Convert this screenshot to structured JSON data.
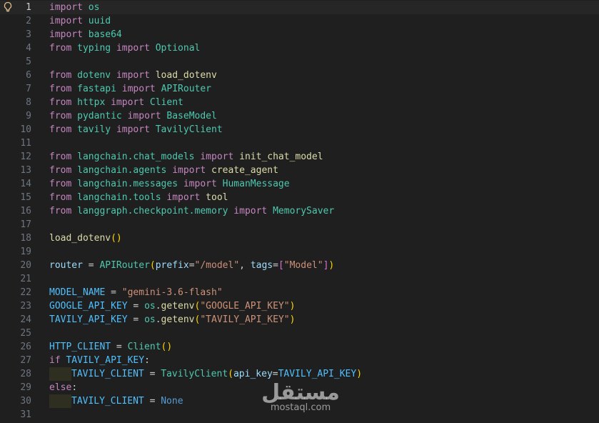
{
  "colors": {
    "background": "#1f1f1f",
    "current_line": "#262626",
    "gutter": "#6e7681",
    "keyword": "#c586c0",
    "module": "#4ec9b0",
    "function": "#dcdcaa",
    "variable": "#9cdcfe",
    "constant": "#4fc1ff",
    "string": "#ce9178",
    "constant_keyword": "#569cd6",
    "plain": "#cccccc",
    "bracket_yellow": "#ffd700",
    "bracket_purple": "#da70d6"
  },
  "gutter_icon": "lightbulb-icon",
  "current_line": 1,
  "lines": [
    {
      "n": "1",
      "t": [
        [
          "import",
          "kw"
        ],
        [
          " ",
          "p"
        ],
        [
          "os",
          "mod"
        ]
      ]
    },
    {
      "n": "2",
      "t": [
        [
          "import",
          "kw"
        ],
        [
          " ",
          "p"
        ],
        [
          "uuid",
          "mod"
        ]
      ]
    },
    {
      "n": "3",
      "t": [
        [
          "import",
          "kw"
        ],
        [
          " ",
          "p"
        ],
        [
          "base64",
          "mod"
        ]
      ]
    },
    {
      "n": "4",
      "t": [
        [
          "from",
          "kw"
        ],
        [
          " ",
          "p"
        ],
        [
          "typing",
          "mod"
        ],
        [
          " ",
          "p"
        ],
        [
          "import",
          "kw"
        ],
        [
          " ",
          "p"
        ],
        [
          "Optional",
          "mod"
        ]
      ]
    },
    {
      "n": "5",
      "t": []
    },
    {
      "n": "6",
      "t": [
        [
          "from",
          "kw"
        ],
        [
          " ",
          "p"
        ],
        [
          "dotenv",
          "mod"
        ],
        [
          " ",
          "p"
        ],
        [
          "import",
          "kw"
        ],
        [
          " ",
          "p"
        ],
        [
          "load_dotenv",
          "fn"
        ]
      ]
    },
    {
      "n": "7",
      "t": [
        [
          "from",
          "kw"
        ],
        [
          " ",
          "p"
        ],
        [
          "fastapi",
          "mod"
        ],
        [
          " ",
          "p"
        ],
        [
          "import",
          "kw"
        ],
        [
          " ",
          "p"
        ],
        [
          "APIRouter",
          "mod"
        ]
      ]
    },
    {
      "n": "8",
      "t": [
        [
          "from",
          "kw"
        ],
        [
          " ",
          "p"
        ],
        [
          "httpx",
          "mod"
        ],
        [
          " ",
          "p"
        ],
        [
          "import",
          "kw"
        ],
        [
          " ",
          "p"
        ],
        [
          "Client",
          "mod"
        ]
      ]
    },
    {
      "n": "9",
      "t": [
        [
          "from",
          "kw"
        ],
        [
          " ",
          "p"
        ],
        [
          "pydantic",
          "mod"
        ],
        [
          " ",
          "p"
        ],
        [
          "import",
          "kw"
        ],
        [
          " ",
          "p"
        ],
        [
          "BaseModel",
          "mod"
        ]
      ]
    },
    {
      "n": "10",
      "t": [
        [
          "from",
          "kw"
        ],
        [
          " ",
          "p"
        ],
        [
          "tavily",
          "mod"
        ],
        [
          " ",
          "p"
        ],
        [
          "import",
          "kw"
        ],
        [
          " ",
          "p"
        ],
        [
          "TavilyClient",
          "mod"
        ]
      ]
    },
    {
      "n": "11",
      "t": []
    },
    {
      "n": "12",
      "t": [
        [
          "from",
          "kw"
        ],
        [
          " ",
          "p"
        ],
        [
          "langchain.chat_models",
          "mod"
        ],
        [
          " ",
          "p"
        ],
        [
          "import",
          "kw"
        ],
        [
          " ",
          "p"
        ],
        [
          "init_chat_model",
          "fn"
        ]
      ]
    },
    {
      "n": "13",
      "t": [
        [
          "from",
          "kw"
        ],
        [
          " ",
          "p"
        ],
        [
          "langchain.agents",
          "mod"
        ],
        [
          " ",
          "p"
        ],
        [
          "import",
          "kw"
        ],
        [
          " ",
          "p"
        ],
        [
          "create_agent",
          "fn"
        ]
      ]
    },
    {
      "n": "14",
      "t": [
        [
          "from",
          "kw"
        ],
        [
          " ",
          "p"
        ],
        [
          "langchain.messages",
          "mod"
        ],
        [
          " ",
          "p"
        ],
        [
          "import",
          "kw"
        ],
        [
          " ",
          "p"
        ],
        [
          "HumanMessage",
          "mod"
        ]
      ]
    },
    {
      "n": "15",
      "t": [
        [
          "from",
          "kw"
        ],
        [
          " ",
          "p"
        ],
        [
          "langchain.tools",
          "mod"
        ],
        [
          " ",
          "p"
        ],
        [
          "import",
          "kw"
        ],
        [
          " ",
          "p"
        ],
        [
          "tool",
          "fn"
        ]
      ]
    },
    {
      "n": "16",
      "t": [
        [
          "from",
          "kw"
        ],
        [
          " ",
          "p"
        ],
        [
          "langgraph.checkpoint.memory",
          "mod"
        ],
        [
          " ",
          "p"
        ],
        [
          "import",
          "kw"
        ],
        [
          " ",
          "p"
        ],
        [
          "MemorySaver",
          "mod"
        ]
      ]
    },
    {
      "n": "17",
      "t": []
    },
    {
      "n": "18",
      "t": [
        [
          "load_dotenv",
          "fn"
        ],
        [
          "()",
          "by"
        ]
      ]
    },
    {
      "n": "19",
      "t": []
    },
    {
      "n": "20",
      "t": [
        [
          "router",
          "var"
        ],
        [
          " = ",
          "p"
        ],
        [
          "APIRouter",
          "mod"
        ],
        [
          "(",
          "by"
        ],
        [
          "prefix",
          "var"
        ],
        [
          "=",
          "p"
        ],
        [
          "\"/model\"",
          "str"
        ],
        [
          ", ",
          "p"
        ],
        [
          "tags",
          "var"
        ],
        [
          "=",
          "p"
        ],
        [
          "[",
          "bp"
        ],
        [
          "\"Model\"",
          "str"
        ],
        [
          "]",
          "bp"
        ],
        [
          ")",
          "by"
        ]
      ]
    },
    {
      "n": "21",
      "t": []
    },
    {
      "n": "22",
      "t": [
        [
          "MODEL_NAME",
          "const"
        ],
        [
          " = ",
          "p"
        ],
        [
          "\"gemini-3.6-flash\"",
          "str"
        ]
      ]
    },
    {
      "n": "23",
      "t": [
        [
          "GOOGLE_API_KEY",
          "const"
        ],
        [
          " = ",
          "p"
        ],
        [
          "os",
          "mod"
        ],
        [
          ".",
          "p"
        ],
        [
          "getenv",
          "fn"
        ],
        [
          "(",
          "by"
        ],
        [
          "\"GOOGLE_API_KEY\"",
          "str"
        ],
        [
          ")",
          "by"
        ]
      ]
    },
    {
      "n": "24",
      "t": [
        [
          "TAVILY_API_KEY",
          "const"
        ],
        [
          " = ",
          "p"
        ],
        [
          "os",
          "mod"
        ],
        [
          ".",
          "p"
        ],
        [
          "getenv",
          "fn"
        ],
        [
          "(",
          "by"
        ],
        [
          "\"TAVILY_API_KEY\"",
          "str"
        ],
        [
          ")",
          "by"
        ]
      ]
    },
    {
      "n": "25",
      "t": []
    },
    {
      "n": "26",
      "t": [
        [
          "HTTP_CLIENT",
          "const"
        ],
        [
          " = ",
          "p"
        ],
        [
          "Client",
          "mod"
        ],
        [
          "()",
          "by"
        ]
      ]
    },
    {
      "n": "27",
      "t": [
        [
          "if",
          "kw"
        ],
        [
          " ",
          "p"
        ],
        [
          "TAVILY_API_KEY",
          "const"
        ],
        [
          ":",
          "p"
        ]
      ]
    },
    {
      "n": "28",
      "indent": true,
      "t": [
        [
          "TAVILY_CLIENT",
          "const"
        ],
        [
          " = ",
          "p"
        ],
        [
          "TavilyClient",
          "mod"
        ],
        [
          "(",
          "by"
        ],
        [
          "api_key",
          "var"
        ],
        [
          "=",
          "p"
        ],
        [
          "TAVILY_API_KEY",
          "const"
        ],
        [
          ")",
          "by"
        ]
      ]
    },
    {
      "n": "29",
      "t": [
        [
          "else",
          "kw"
        ],
        [
          ":",
          "p"
        ]
      ]
    },
    {
      "n": "30",
      "indent": true,
      "t": [
        [
          "TAVILY_CLIENT",
          "const"
        ],
        [
          " = ",
          "p"
        ],
        [
          "None",
          "ck"
        ]
      ]
    },
    {
      "n": "31",
      "t": []
    }
  ],
  "watermark": {
    "logo": "مستقل",
    "domain": "mostaql.com"
  }
}
